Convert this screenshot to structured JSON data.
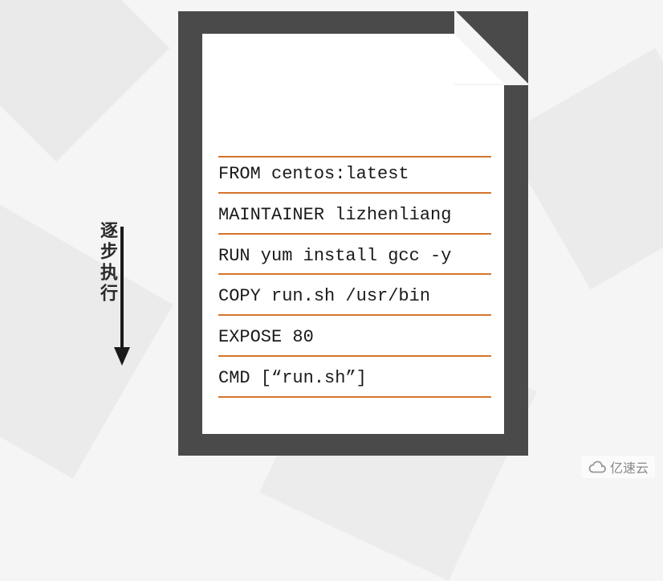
{
  "arrow": {
    "label": "逐步执行"
  },
  "dockerfile": {
    "lines": [
      "FROM centos:latest",
      "MAINTAINER lizhenliang",
      "RUN yum install gcc -y",
      "COPY run.sh /usr/bin",
      "EXPOSE 80",
      "CMD [“run.sh”]"
    ]
  },
  "watermark": {
    "text": "亿速云"
  },
  "colors": {
    "file_border": "#4a4a4a",
    "line_color": "#d4752c",
    "text_color": "#1a1a1a"
  }
}
